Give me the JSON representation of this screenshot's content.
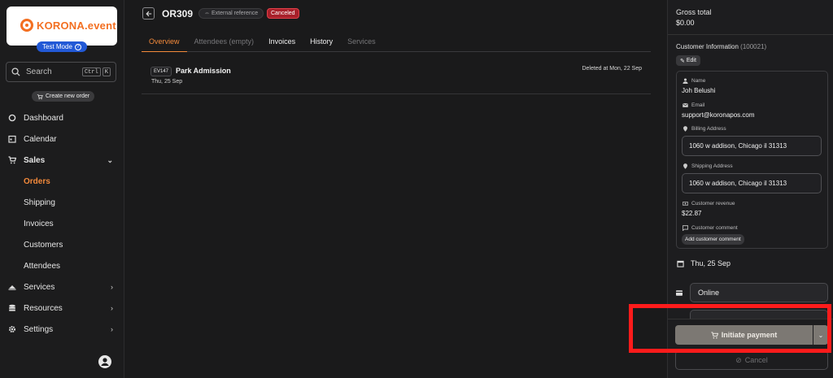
{
  "sidebar": {
    "logo_text": "KORONA.event",
    "test_mode": "Test Mode",
    "search": {
      "placeholder": "Search",
      "shortcut_1": "Ctrl",
      "shortcut_2": "K"
    },
    "create_order": "Create new order",
    "items": [
      {
        "label": "Dashboard",
        "icon": "dashboard-icon"
      },
      {
        "label": "Calendar",
        "icon": "calendar-icon"
      },
      {
        "label": "Sales",
        "icon": "cart-icon",
        "expanded": true
      },
      {
        "label": "Orders",
        "active": true
      },
      {
        "label": "Shipping"
      },
      {
        "label": "Invoices"
      },
      {
        "label": "Customers"
      },
      {
        "label": "Attendees"
      },
      {
        "label": "Services",
        "icon": "services-icon"
      },
      {
        "label": "Resources",
        "icon": "database-icon"
      },
      {
        "label": "Settings",
        "icon": "gear-icon"
      }
    ]
  },
  "header": {
    "order_id": "OR309",
    "external_reference": "External reference",
    "status": "Canceled"
  },
  "tabs": [
    "Overview",
    "Attendees (empty)",
    "Invoices",
    "History",
    "Services"
  ],
  "order_item": {
    "event_code": "EV147",
    "name": "Park Admission",
    "date": "Thu, 25 Sep",
    "deleted": "Deleted at Mon, 22 Sep"
  },
  "panel": {
    "gross_total_label": "Gross total",
    "gross_total_value": "$0.00",
    "customer_info_label": "Customer Information",
    "customer_number": "(100021)",
    "edit": "Edit",
    "name_label": "Name",
    "name": "Joh Belushi",
    "email_label": "Email",
    "email": "support@koronapos.com",
    "billing_label": "Billing Address",
    "billing": "1060 w addison, Chicago il  31313",
    "shipping_label": "Shipping Address",
    "shipping": "1060 w addison, Chicago il  31313",
    "revenue_label": "Customer revenue",
    "revenue": "$22.87",
    "comment_label": "Customer comment",
    "add_comment": "Add customer comment",
    "date": "Thu, 25 Sep",
    "channel": "Online",
    "initiate_payment": "Initiate payment",
    "cancel": "Cancel"
  },
  "colors": {
    "accent": "#f48a3b",
    "brand": "#f36f21",
    "danger": "#a8202a",
    "highlight": "#ff1b1b"
  }
}
